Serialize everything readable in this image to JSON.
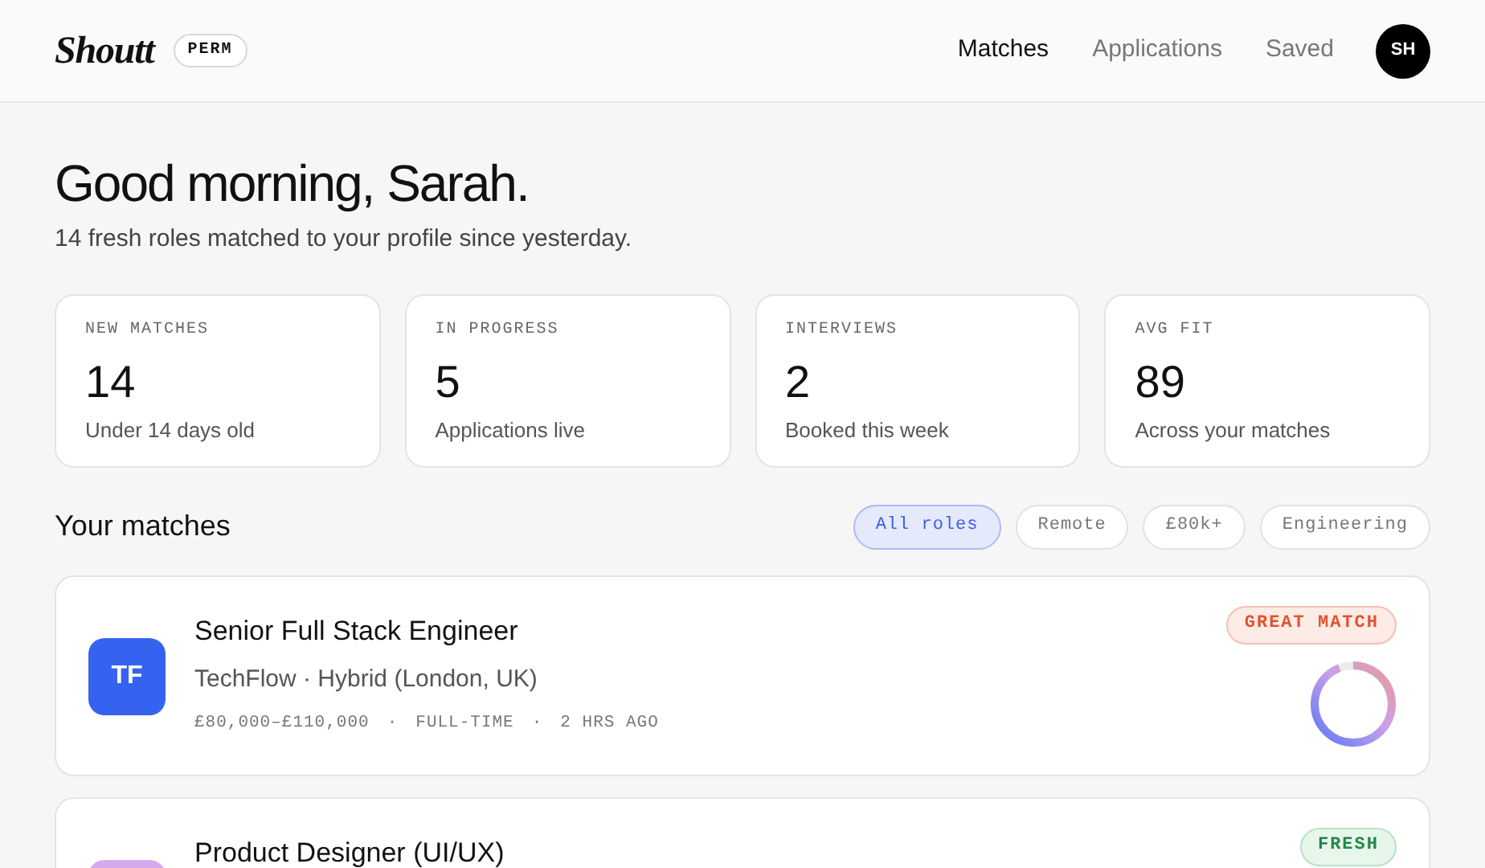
{
  "header": {
    "logo": "Shoutt",
    "badge": "PERM",
    "nav": [
      {
        "label": "Matches",
        "selected": true
      },
      {
        "label": "Applications",
        "selected": false
      },
      {
        "label": "Saved",
        "selected": false
      }
    ],
    "avatar": "SH"
  },
  "greeting": {
    "title": "Good morning, Sarah.",
    "subtitle": "14 fresh roles matched to your profile since yesterday."
  },
  "stats": [
    {
      "label": "NEW MATCHES",
      "value": "14",
      "caption": "Under 14 days old"
    },
    {
      "label": "IN PROGRESS",
      "value": "5",
      "caption": "Applications live"
    },
    {
      "label": "INTERVIEWS",
      "value": "2",
      "caption": "Booked this week"
    },
    {
      "label": "AVG FIT",
      "value": "89",
      "caption": "Across your matches"
    }
  ],
  "matches": {
    "title": "Your matches",
    "filters": [
      {
        "label": "All roles",
        "selected": true
      },
      {
        "label": "Remote",
        "selected": false
      },
      {
        "label": "£80k+",
        "selected": false
      },
      {
        "label": "Engineering",
        "selected": false
      }
    ],
    "items": [
      {
        "initials": "TF",
        "color": "#3563f0",
        "title": "Senior Full Stack Engineer",
        "company": "TechFlow · Hybrid (London, UK)",
        "meta": [
          "£80,000–£110,000",
          "·",
          "FULL-TIME",
          "·",
          "2 HRS AGO"
        ],
        "badge": {
          "kind": "great",
          "label": "GREAT MATCH"
        },
        "level": 0.94
      },
      {
        "color": "#d6a8ec",
        "title": "Product Designer (UI/UX)",
        "badge": {
          "kind": "fresh",
          "label": "FRESH"
        }
      }
    ]
  }
}
